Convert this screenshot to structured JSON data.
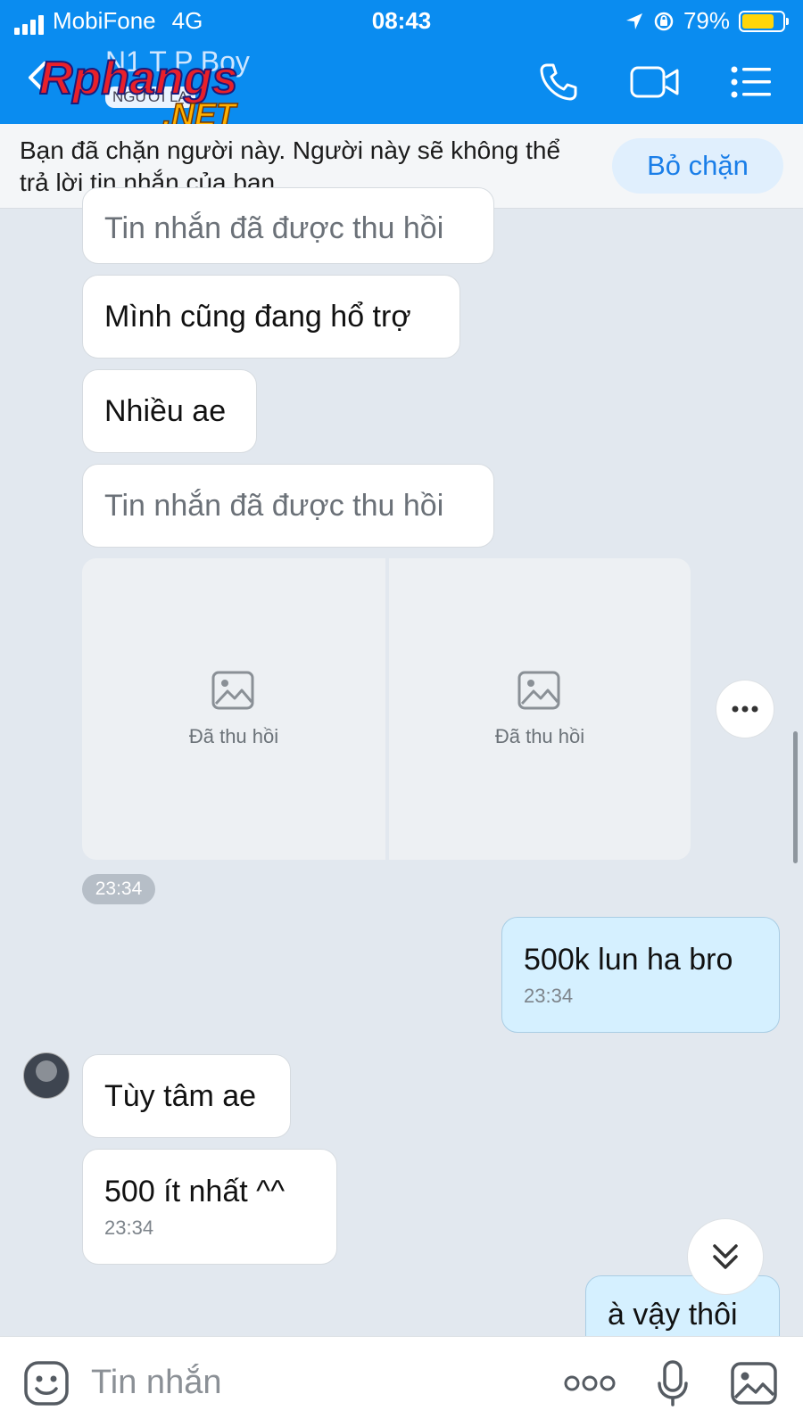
{
  "status_bar": {
    "carrier": "MobiFone",
    "network": "4G",
    "time": "08:43",
    "battery": "79%",
    "battery_level": 0.79
  },
  "header": {
    "title": "N1 T P Boy",
    "subtitle": "NGƯỜI LẠ",
    "watermark_brand": "Rphangs",
    "watermark_tld": ".NET",
    "icons": [
      "back-icon",
      "phone-icon",
      "video-camera-icon",
      "menu-list-icon"
    ]
  },
  "banner": {
    "text": "Bạn đã chặn người này. Người này sẽ không thể trả lời tin nhắn của bạn.",
    "unblock_label": "Bỏ chặn"
  },
  "messages": {
    "recalled_top": "Tin nhắn đã được thu hồi",
    "m1": "Mình cũng đang hổ trợ",
    "m2": "Nhiều ae",
    "recalled_2": "Tin nhắn đã được thu hồi",
    "image_recalled_1": "Đã thu hồi",
    "image_recalled_2": "Đã thu hồi",
    "group_time": "23:34",
    "sent_1": "500k lun ha bro",
    "sent_1_time": "23:34",
    "m3": "Tùy tâm ae",
    "m4": "500 ít nhất ^^",
    "m4_time": "23:34",
    "sent_2": "à vậy thôi"
  },
  "input_bar": {
    "placeholder": "Tin nhắn",
    "icons": [
      "emoji-icon",
      "more-options-icon",
      "microphone-icon",
      "image-icon"
    ]
  }
}
